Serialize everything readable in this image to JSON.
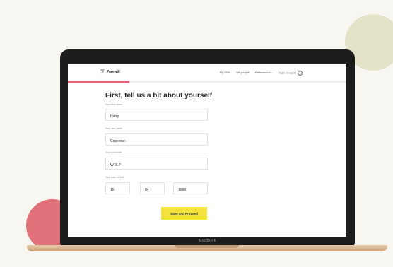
{
  "device": {
    "brand": "MacBook"
  },
  "colors": {
    "accent_pink": "#e4676f",
    "button_yellow": "#f3e23a",
    "circle_sage": "#e4e3c9"
  },
  "app": {
    "logo_mark": "ℱ",
    "logo_text": "Farewill"
  },
  "nav": {
    "links": [
      {
        "label": "My Wills"
      },
      {
        "label": "Gift people"
      },
      {
        "label": "Preferences ⌄"
      },
      {
        "label": "Earn rewards"
      }
    ],
    "rewards_icon": "circle-info-icon"
  },
  "progress": {
    "fraction": 0.22
  },
  "form": {
    "title": "First, tell us a bit about yourself",
    "first_name": {
      "label": "Your first name",
      "value": "Harry"
    },
    "last_name": {
      "label": "Your last name",
      "value": "Copeman"
    },
    "postcode": {
      "label": "Your postcode",
      "value": "W 3LP"
    },
    "dob": {
      "label": "Your date of birth",
      "day": "15",
      "month": "04",
      "year": "1988"
    },
    "submit_label": "Save and Proceed"
  }
}
